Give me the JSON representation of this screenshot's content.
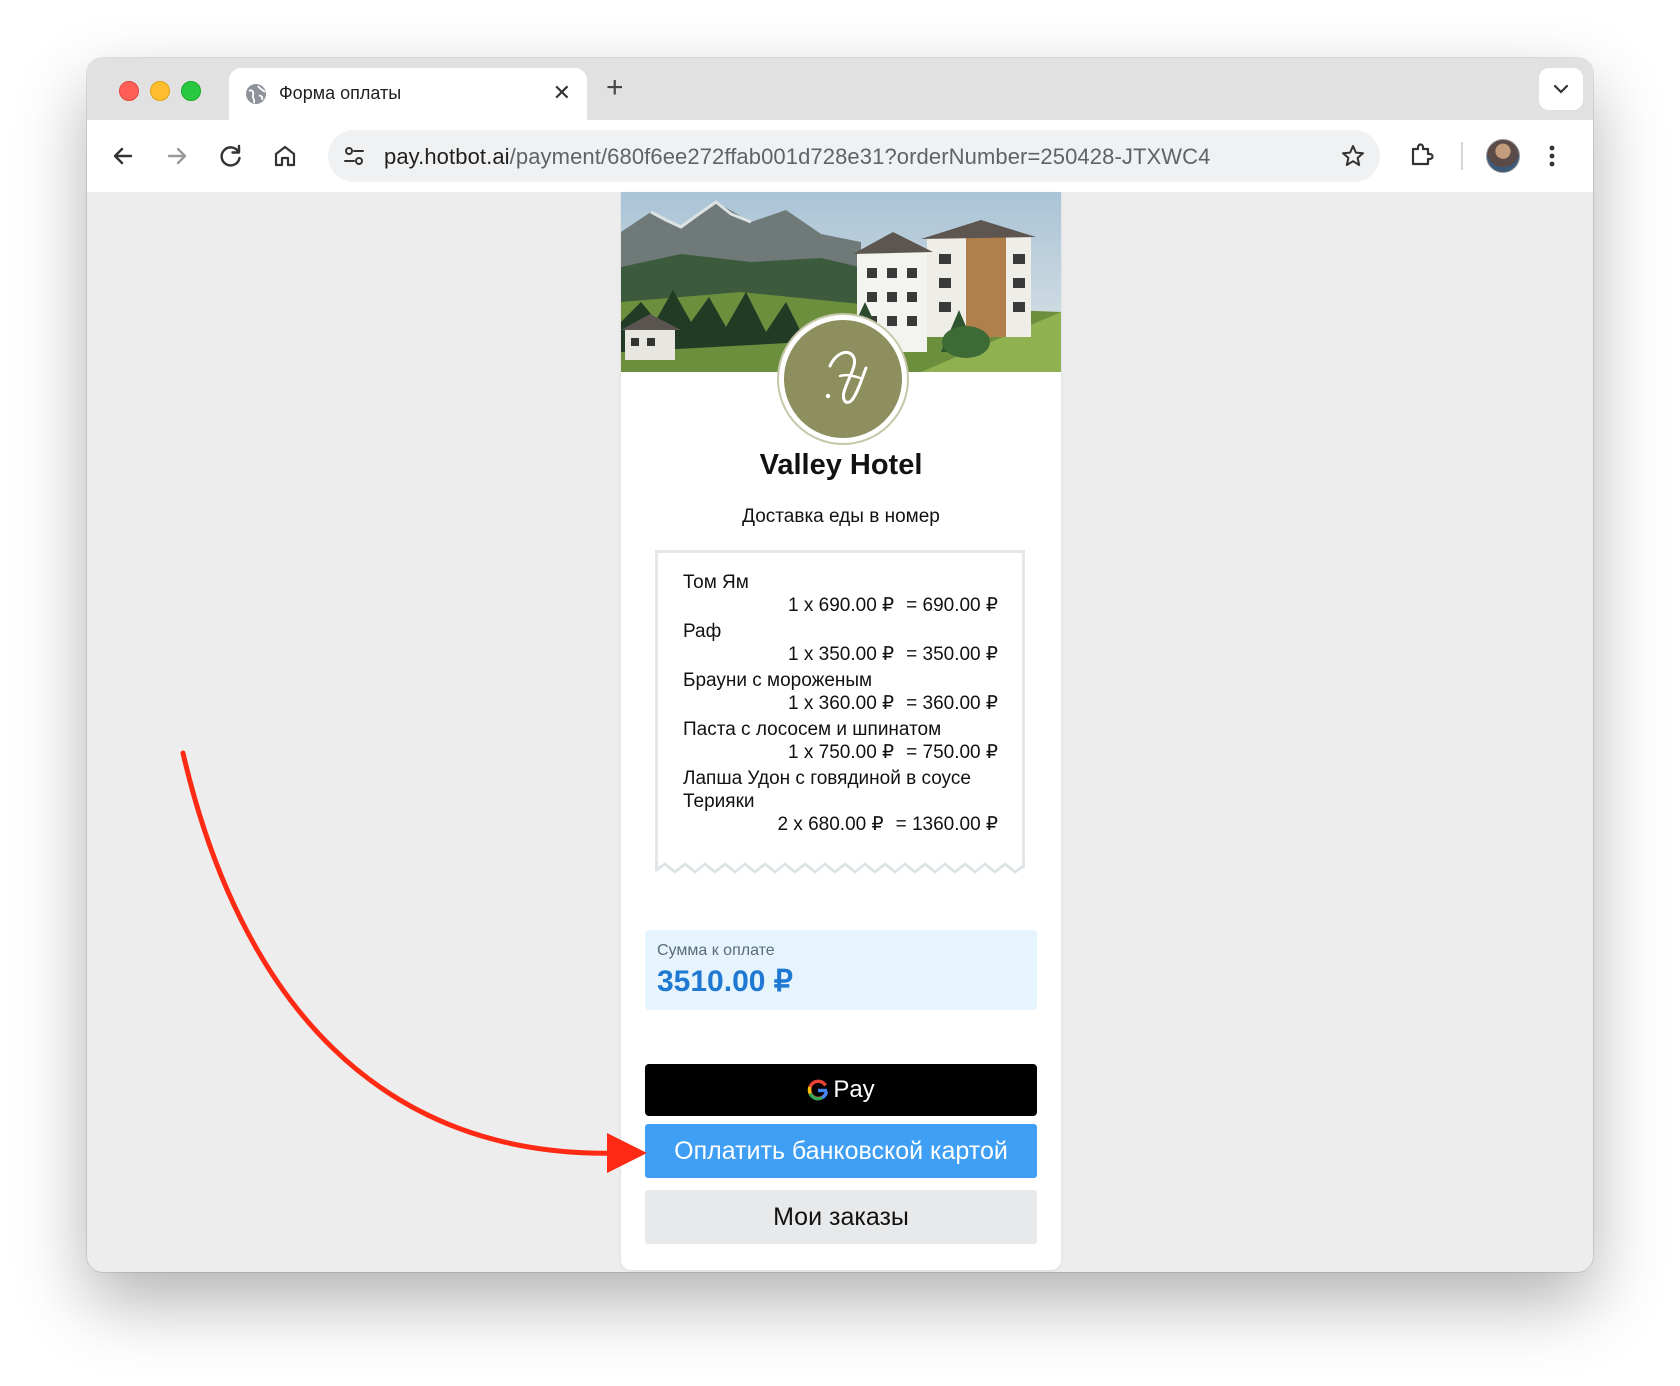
{
  "browser": {
    "tab_title": "Форма оплаты",
    "url_host": "pay.hotbot.ai",
    "url_path": "/payment/680f6ee272ffab001d728e31?orderNumber=250428-JTXWC4"
  },
  "hotel": {
    "name": "Valley Hotel",
    "service": "Доставка еды в номер"
  },
  "items": [
    {
      "name": "Том Ям",
      "qty": "1",
      "price": "690.00 ₽",
      "total": "= 690.00 ₽"
    },
    {
      "name": "Раф",
      "qty": "1",
      "price": "350.00 ₽",
      "total": "= 350.00 ₽"
    },
    {
      "name": "Брауни с мороженым",
      "qty": "1",
      "price": "360.00 ₽",
      "total": "= 360.00 ₽"
    },
    {
      "name": "Паста с лососем и шпинатом",
      "qty": "1",
      "price": "750.00 ₽",
      "total": "= 750.00 ₽"
    },
    {
      "name": "Лапша Удон с говядиной в соусе Терияки",
      "qty": "2",
      "price": "680.00 ₽",
      "total": "= 1360.00 ₽"
    }
  ],
  "total": {
    "label": "Сумма к оплате",
    "value": "3510.00 ₽"
  },
  "buttons": {
    "gpay": "Pay",
    "card": "Оплатить банковской картой",
    "orders": "Мои заказы"
  },
  "colors": {
    "accent_blue": "#3f9ff5",
    "total_text": "#1f78d1",
    "annotation_arrow": "#ff2a14",
    "logo_olive": "#8d8f5e"
  }
}
